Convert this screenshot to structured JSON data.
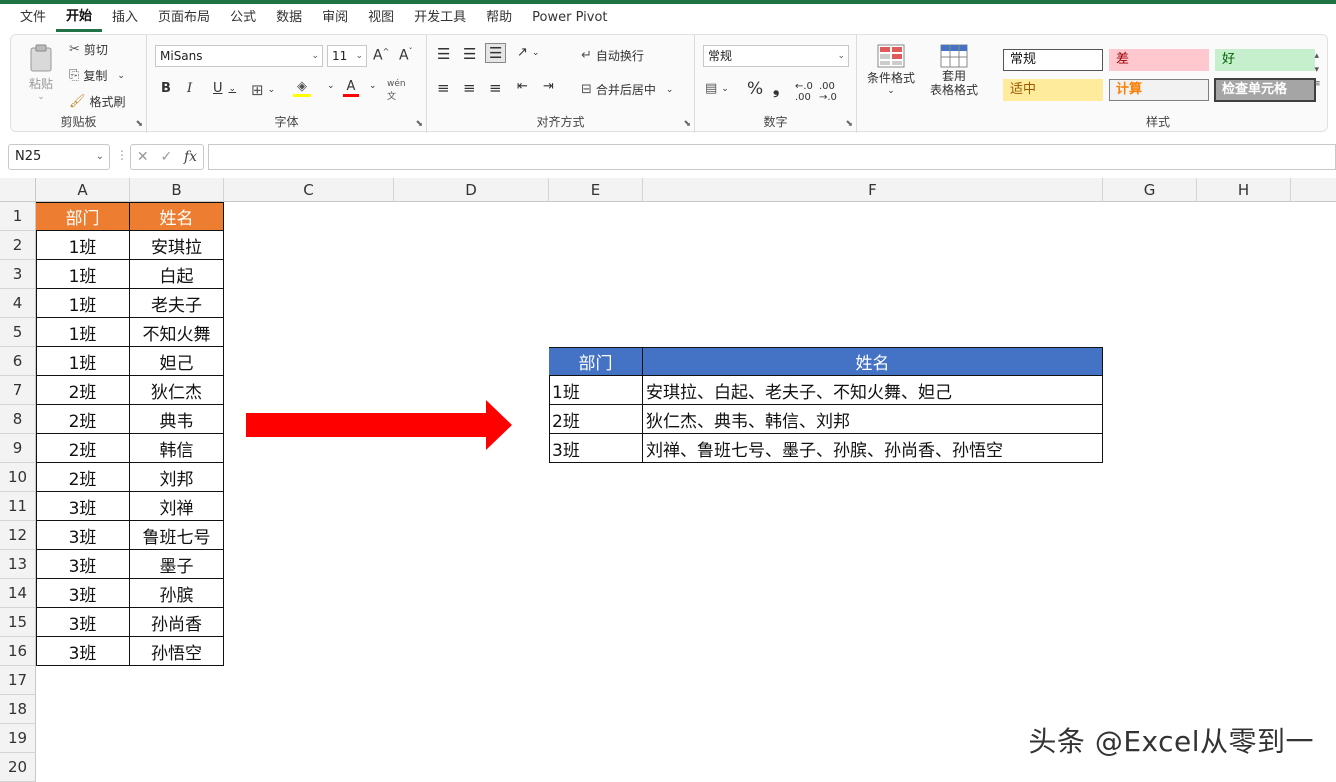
{
  "menu": [
    "文件",
    "开始",
    "插入",
    "页面布局",
    "公式",
    "数据",
    "审阅",
    "视图",
    "开发工具",
    "帮助",
    "Power Pivot"
  ],
  "active_menu_index": 1,
  "ribbon": {
    "clipboard": {
      "paste": "粘贴",
      "cut": "剪切",
      "copy": "复制",
      "format_painter": "格式刷",
      "label": "剪贴板"
    },
    "font": {
      "name": "MiSans",
      "size": "11",
      "bold": "B",
      "italic": "I",
      "underline": "U",
      "label": "字体"
    },
    "alignment": {
      "wrap": "自动换行",
      "merge": "合并后居中",
      "label": "对齐方式"
    },
    "number": {
      "format": "常规",
      "percent": "%",
      "comma": "❟",
      "label": "数字"
    },
    "styles": {
      "conditional": "条件格式",
      "table_line1": "套用",
      "table_line2": "表格格式",
      "cells": [
        {
          "text": "常规",
          "bg": "#ffffff",
          "color": "#111111",
          "border": "#555555"
        },
        {
          "text": "差",
          "bg": "#ffc7ce",
          "color": "#9c0006",
          "border": "#ffc7ce"
        },
        {
          "text": "好",
          "bg": "#c6efce",
          "color": "#006100",
          "border": "#c6efce"
        },
        {
          "text": "适中",
          "bg": "#ffeb9c",
          "color": "#9c5700",
          "border": "#ffeb9c"
        },
        {
          "text": "计算",
          "bg": "#f2f2f2",
          "color": "#fa7d00",
          "border": "#7f7f7f"
        },
        {
          "text": "检查单元格",
          "bg": "#a5a5a5",
          "color": "#ffffff",
          "border": "#3f3f3f"
        }
      ],
      "label": "样式"
    }
  },
  "namebox": "N25",
  "columns": [
    {
      "name": "A",
      "width": 94
    },
    {
      "name": "B",
      "width": 94
    },
    {
      "name": "C",
      "width": 170
    },
    {
      "name": "D",
      "width": 155
    },
    {
      "name": "E",
      "width": 94
    },
    {
      "name": "F",
      "width": 460
    },
    {
      "name": "G",
      "width": 94
    },
    {
      "name": "H",
      "width": 94
    },
    {
      "name": "",
      "width": 60
    }
  ],
  "rows": [
    "1",
    "2",
    "3",
    "4",
    "5",
    "6",
    "7",
    "8",
    "9",
    "10",
    "11",
    "12",
    "13",
    "14",
    "15",
    "16",
    "17",
    "18",
    "19",
    "20"
  ],
  "source_table": {
    "header": [
      "部门",
      "姓名"
    ],
    "rows": [
      [
        "1班",
        "安琪拉"
      ],
      [
        "1班",
        "白起"
      ],
      [
        "1班",
        "老夫子"
      ],
      [
        "1班",
        "不知火舞"
      ],
      [
        "1班",
        "妲己"
      ],
      [
        "2班",
        "狄仁杰"
      ],
      [
        "2班",
        "典韦"
      ],
      [
        "2班",
        "韩信"
      ],
      [
        "2班",
        "刘邦"
      ],
      [
        "3班",
        "刘禅"
      ],
      [
        "3班",
        "鲁班七号"
      ],
      [
        "3班",
        "墨子"
      ],
      [
        "3班",
        "孙膑"
      ],
      [
        "3班",
        "孙尚香"
      ],
      [
        "3班",
        "孙悟空"
      ]
    ]
  },
  "result_table": {
    "header": [
      "部门",
      "姓名"
    ],
    "rows": [
      [
        "1班",
        "安琪拉、白起、老夫子、不知火舞、妲己"
      ],
      [
        "2班",
        "狄仁杰、典韦、韩信、刘邦"
      ],
      [
        "3班",
        "刘禅、鲁班七号、墨子、孙膑、孙尚香、孙悟空"
      ]
    ]
  },
  "colors": {
    "source_header": "#ed7d31",
    "result_header": "#4472c4",
    "arrow": "#ff0000",
    "accent": "#217346"
  },
  "watermark": "头条 @Excel从零到一"
}
